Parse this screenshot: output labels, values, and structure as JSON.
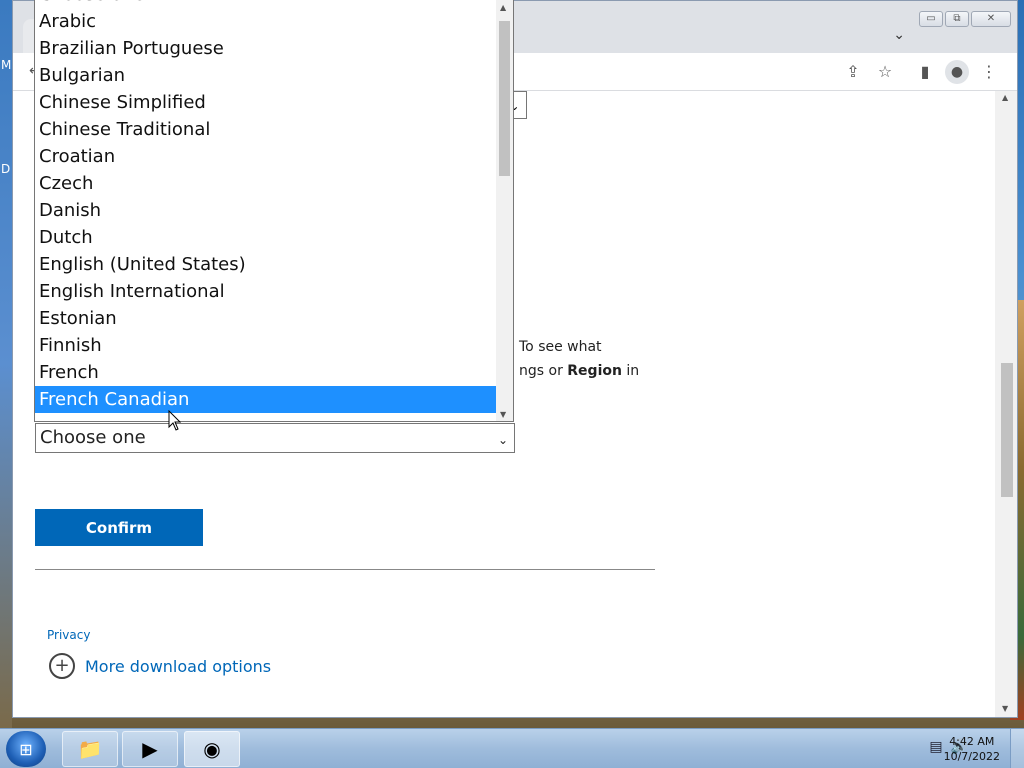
{
  "desktop": {
    "frag_top": "M",
    "frag_mid": "D"
  },
  "browser": {
    "window_controls": {
      "minimize": "▭",
      "maximize": "⧉",
      "close": "✕"
    },
    "tab_dropdown_icon": "chevron-down-icon",
    "toolbar": {
      "icons": [
        "share-icon",
        "star-icon",
        "side-panel-icon",
        "profile-icon",
        "menu-icon"
      ]
    }
  },
  "page": {
    "paragraph_line1": "To see what",
    "paragraph_line2_pre": "ngs or ",
    "paragraph_line2_bold": "Region",
    "paragraph_line2_post": " in",
    "language_select": {
      "value": "Choose one",
      "options": [
        "Choose one",
        "Arabic",
        "Brazilian Portuguese",
        "Bulgarian",
        "Chinese Simplified",
        "Chinese Traditional",
        "Croatian",
        "Czech",
        "Danish",
        "Dutch",
        "English (United States)",
        "English International",
        "Estonian",
        "Finnish",
        "French",
        "French Canadian"
      ],
      "highlighted_option": "French Canadian"
    },
    "confirm_label": "Confirm",
    "privacy_label": "Privacy",
    "more_download_label": "More download options"
  },
  "taskbar": {
    "clock_time": "4:42 AM",
    "clock_date": "10/7/2022"
  },
  "colors": {
    "accent": "#0067b8",
    "highlight": "#1e90ff"
  }
}
